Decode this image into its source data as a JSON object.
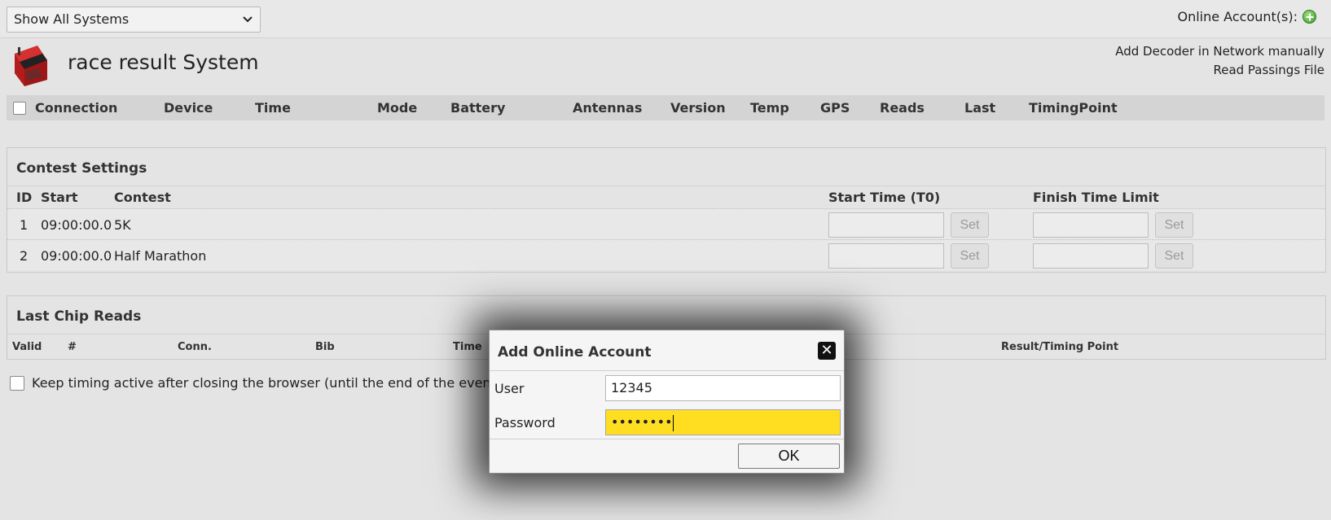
{
  "topbar": {
    "system_select": {
      "value": "Show All Systems"
    },
    "online_accounts_label": "Online Account(s):"
  },
  "system": {
    "title": "race result System",
    "links": [
      "Add Decoder in Network manually",
      "Read Passings File"
    ]
  },
  "device_table": {
    "columns": [
      "Connection",
      "Device",
      "Time",
      "Mode",
      "Battery",
      "Antennas",
      "Version",
      "Temp",
      "GPS",
      "Reads",
      "Last",
      "TimingPoint"
    ]
  },
  "contest_settings": {
    "title": "Contest Settings",
    "headers": {
      "id": "ID",
      "start": "Start",
      "contest": "Contest",
      "start_time": "Start Time (T0)",
      "finish_limit": "Finish Time Limit"
    },
    "set_label": "Set",
    "rows": [
      {
        "id": "1",
        "start": "09:00:00.0",
        "contest": "5K"
      },
      {
        "id": "2",
        "start": "09:00:00.0",
        "contest": "Half Marathon"
      }
    ]
  },
  "chip_reads": {
    "title": "Last Chip Reads",
    "headers": {
      "valid": "Valid",
      "num": "#",
      "conn": "Conn.",
      "bib": "Bib",
      "time": "Time",
      "result": "Result/Timing Point"
    }
  },
  "keep_active_label": "Keep timing active after closing the browser (until the end of the event)",
  "dialog": {
    "title": "Add Online Account",
    "user_label": "User",
    "user_value": "12345",
    "password_label": "Password",
    "password_masked": "••••••••",
    "ok_label": "OK",
    "close_glyph": "✕"
  },
  "colors": {
    "password_highlight": "#ffde22",
    "plus_icon": "#3c9b2a"
  },
  "icons": [
    "chevron-down-icon",
    "add-account-icon",
    "race-result-logo",
    "close-icon"
  ]
}
